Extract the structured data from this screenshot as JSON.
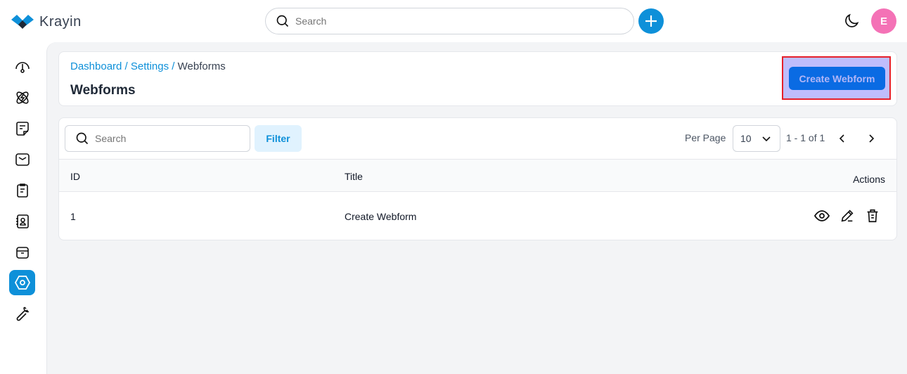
{
  "app": {
    "name": "Krayin",
    "accent": "#0e90d9"
  },
  "header": {
    "search_placeholder": "Search",
    "avatar_initial": "E"
  },
  "sidebar": {
    "items": [
      {
        "name": "dashboard",
        "icon": "gauge-icon"
      },
      {
        "name": "leads",
        "icon": "atom-icon"
      },
      {
        "name": "quotes",
        "icon": "note-icon"
      },
      {
        "name": "mail",
        "icon": "mail-icon"
      },
      {
        "name": "activities",
        "icon": "clipboard-icon"
      },
      {
        "name": "contacts",
        "icon": "contact-book-icon"
      },
      {
        "name": "products",
        "icon": "archive-box-icon"
      },
      {
        "name": "settings",
        "icon": "settings-hexagon-icon",
        "active": true
      },
      {
        "name": "configuration",
        "icon": "wrench-icon"
      }
    ]
  },
  "breadcrumb": {
    "items": [
      "Dashboard",
      "Settings"
    ],
    "current": "Webforms",
    "sep": " / "
  },
  "page": {
    "title": "Webforms",
    "create_label": "Create Webform"
  },
  "toolbar": {
    "search_placeholder": "Search",
    "filter_label": "Filter",
    "per_page_label": "Per Page",
    "per_page_value": "10",
    "pagination": "1 - 1 of 1"
  },
  "table": {
    "columns": {
      "id": "ID",
      "title": "Title",
      "actions": "Actions"
    },
    "rows": [
      {
        "id": "1",
        "title": "Create Webform"
      }
    ]
  }
}
